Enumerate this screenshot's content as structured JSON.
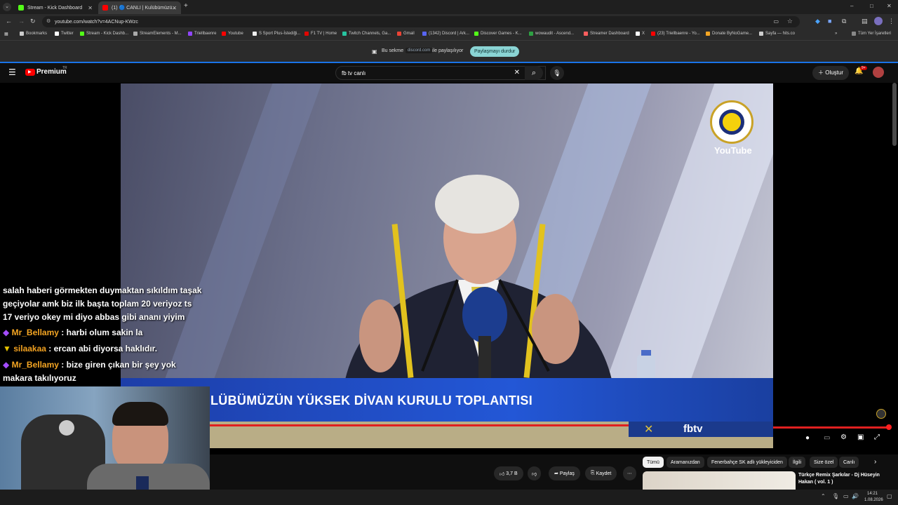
{
  "browser": {
    "tabs": [
      {
        "label": "Stream - Kick Dashboard",
        "active": false
      },
      {
        "label": "(1) 🔵 CANLI | Kulübümüzü...",
        "active": true
      }
    ],
    "new_tab": "+",
    "url": "youtube.com/watch?v=4ACNup-KWzc",
    "window_controls": [
      "–",
      "□",
      "✕"
    ],
    "bookmarks": [
      "Bookmarks",
      "Twitter",
      "Stream - Kick Dashb...",
      "StreamElements - M...",
      "Triellbaenre",
      "Youtube",
      "S Sport Plus-İstediği...",
      "F1 TV | Home",
      "Twitch Channels, Ga...",
      "Gmail",
      "(1342) Discord | Ark...",
      "Discover Games - K...",
      "wowaudit - Ascend...",
      "Streamer Dashboard",
      "X",
      "(23) Triellbaenre - Yo...",
      "Donate ByNoGame...",
      "Sayfa — hits.co"
    ],
    "all_bookmarks": "Tüm Yer İşaretleri",
    "share": {
      "prefix": "Bu sekme",
      "domain": "discord.com",
      "suffix": "ile paylaşılıyor",
      "stop_button": "Paylaşmayı durdur"
    }
  },
  "youtube": {
    "logo_text": "Premium",
    "logo_sup": "TR",
    "search_value": "fb tv canlı",
    "create_button": "Oluştur",
    "notif_count": "9+"
  },
  "video": {
    "banner_text": "LÜBÜMÜZÜN YÜKSEK DİVAN KURULU TOPLANTISI",
    "watermark": "YouTube",
    "channel_tag": "fbtv",
    "progress": 1.0
  },
  "chat": {
    "messages": [
      {
        "user": "",
        "text": "salah haberi görmekten duymaktan sıkıldım taşak"
      },
      {
        "user": "",
        "text": "geçiyolar amk biz ilk başta toplam 20 veriyoz ts"
      },
      {
        "user": "",
        "text": "17 veriyo okey mi diyo abbas gibi ananı yiyim"
      },
      {
        "user": "Mr_Bellamy",
        "text": ": harbi olum sakin la"
      },
      {
        "user": "silaakaa",
        "text": ": ercan abi diyorsa haklıdır."
      },
      {
        "user": "Mr_Bellamy",
        "text": ": bize giren çıkan bir şey yok"
      },
      {
        "user": "",
        "text": "makara takılıyoruz"
      }
    ]
  },
  "actions": {
    "like_count": "3,7 B",
    "share": "Paylaş",
    "save": "Kaydet",
    "more": "⋯"
  },
  "chips": [
    "Tümü",
    "Aramanızdan",
    "Fenerbahçe SK adlı yükleyiciden",
    "İlgili",
    "Size özel",
    "Canlı"
  ],
  "recommendation": {
    "title": "Türkçe Remix Şarkılar - Dj Hüseyin Hakan ( vol. 1 )"
  },
  "taskbar": {
    "time": "14:21",
    "date": "1.08.2026"
  },
  "colors": {
    "accent_red": "#ff0000",
    "share_blue": "#1a73e8",
    "stop_button": "#8ad4d4",
    "banner_blue": "#2357d6",
    "chat_name": "#f5a623"
  }
}
